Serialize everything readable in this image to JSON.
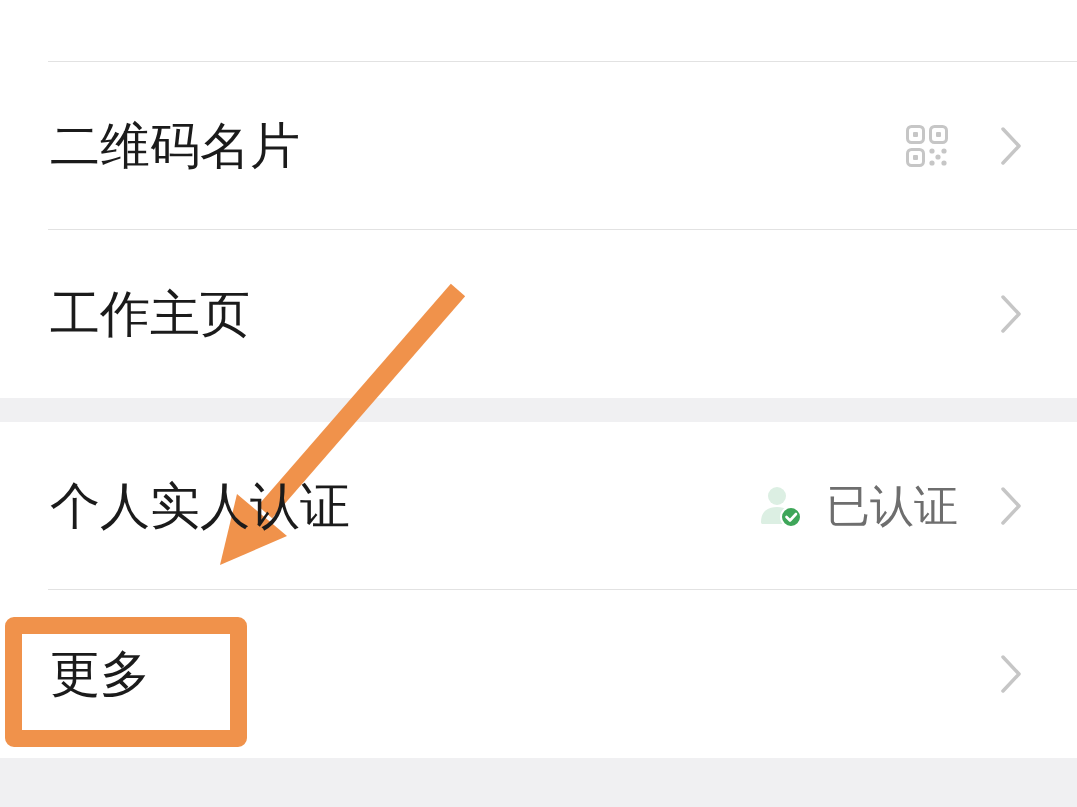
{
  "groups": [
    {
      "items": [
        {
          "kind": "partial",
          "highlighted": false
        },
        {
          "kind": "qr",
          "label": "二维码名片",
          "highlighted": false
        },
        {
          "kind": "plain",
          "label": "工作主页",
          "highlighted": false
        }
      ]
    },
    {
      "items": [
        {
          "kind": "status",
          "label": "个人实人认证",
          "value": "已认证",
          "verified": true,
          "highlighted": false
        },
        {
          "kind": "plain",
          "label": "更多",
          "highlighted": true
        }
      ]
    }
  ],
  "annotations": [
    {
      "kind": "arrow"
    }
  ]
}
